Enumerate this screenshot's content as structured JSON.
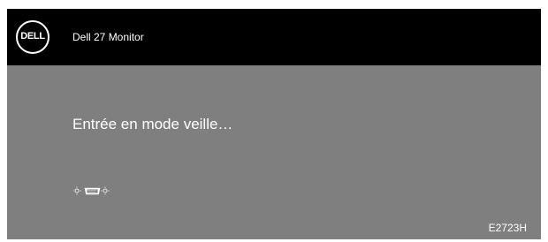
{
  "header": {
    "logo_text": "DELL",
    "product_name": "Dell 27 Monitor"
  },
  "message": "Entrée en mode veille…",
  "input_status": {
    "icon": "vga-connector-icon",
    "left_indicator": "sun-icon",
    "right_indicator": "sun-icon"
  },
  "model": "E2723H",
  "colors": {
    "header_bg": "#000000",
    "panel_bg": "#7f7f7f",
    "text": "#ffffff"
  }
}
